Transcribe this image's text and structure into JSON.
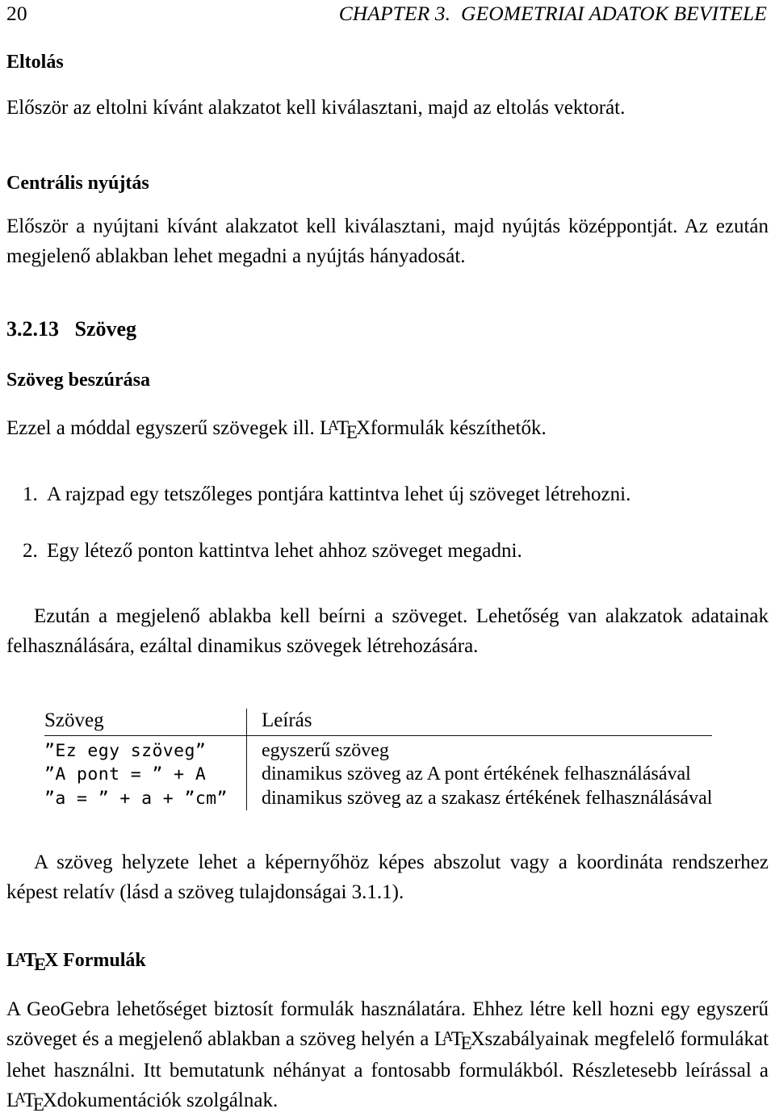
{
  "header": {
    "folio": "20",
    "chapter_title": "CHAPTER 3.  GEOMETRIAI ADATOK BEVITELE"
  },
  "sections": {
    "eltolas": {
      "heading": "Eltolás",
      "paragraph": "Először az eltolni kívánt alakzatot kell kiválasztani, majd az eltolás vektorát."
    },
    "centralis_nyujtas": {
      "heading": "Centrális nyújtás",
      "paragraph": "Először a nyújtani kívánt alakzatot kell kiválasztani, majd nyújtás középpontját. Az ezután megjelenő ablakban lehet megadni a nyújtás hányadosát."
    },
    "szoveg": {
      "number": "3.2.13",
      "title": "Szöveg",
      "subheading": "Szöveg beszúrása",
      "intro_before_logo": "Ezzel a móddal egyszerű szövegek ill. ",
      "intro_after_logo": "formulák készíthetők.",
      "list": [
        {
          "num": "1.",
          "text": "A rajzpad egy tetszőleges pontjára kattintva lehet új szöveget létrehozni."
        },
        {
          "num": "2.",
          "text": "Egy létező ponton kattintva lehet ahhoz szöveget megadni."
        }
      ],
      "after_list_paragraph": "Ezután a megjelenő ablakba kell beírni a szöveget. Lehetőség van alakzatok adatainak felhasználására, ezáltal dinamikus szövegek létrehozására.",
      "table": {
        "columns": [
          "Szöveg",
          "Leírás"
        ],
        "rows": [
          {
            "code": "”Ez egy szöveg”",
            "desc": "egyszerű szöveg"
          },
          {
            "code": "”A pont = ” + A",
            "desc": "dinamikus szöveg az A pont értékének felhasználásával"
          },
          {
            "code": "”a = ” + a + ”cm”",
            "desc": "dinamikus szöveg az a szakasz értékének felhasználásával"
          }
        ]
      },
      "closing_paragraph": "A szöveg helyzete lehet a képernyőhöz képes abszolut vagy a koordináta rendszerhez képest relatív (lásd a szöveg tulajdonságai 3.1.1)."
    },
    "latex_formulak": {
      "heading_suffix": " Formulák",
      "para_part1": "A GeoGebra lehetőséget biztosít formulák használatára.  Ehhez létre kell hozni egy egyszerű szöveget és a megjelenő ablakban a szöveg helyén a ",
      "para_part2": "szabályainak megfelelő formulákat lehet használni.  Itt bemutatunk néhányat a fontosabb formulákból.  Részletesebb leírással a ",
      "para_part3": "dokumentációk szolgálnak."
    }
  },
  "latex_logo": {
    "l": "L",
    "a": "A",
    "t": "T",
    "e": "E",
    "x": "X"
  }
}
